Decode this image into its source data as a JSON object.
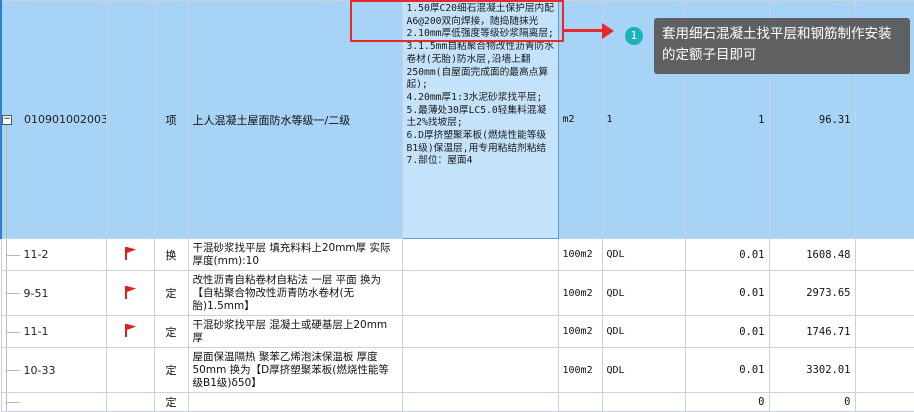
{
  "main_row": {
    "expander": "−",
    "code": "010901002003",
    "type": "项",
    "name": "上人混凝土屋面防水等级一/二级",
    "description": [
      "1.50厚C20细石混凝土保护层内配A6@200双向焊接，随捣随抹光",
      "2.10mm厚低强度等级砂浆隔离层;",
      "3.1.5mm自粘聚合物改性沥青防水卷材(无胎)防水层,沿墙上翻250mm(自屋面完成面的最高点算起);",
      "4.20mm厚1:3水泥砂浆找平层;",
      "5.最薄处30厚LC5.0轻集料混凝土2%找坡层;",
      "6.D厚挤塑聚苯板(燃烧性能等级B1级)保温层,用专用粘结剂粘结",
      "7.部位：屋面4"
    ],
    "unit": "m2",
    "quantity_expr": "1",
    "quantity": "1",
    "price": "96.31"
  },
  "sub_rows": [
    {
      "code": "11-2",
      "flag": true,
      "type": "换",
      "name": "干混砂浆找平层 填充料料上20mm厚  实际厚度(mm):10",
      "unit": "100m2",
      "expr": "QDL",
      "qty": "0.01",
      "price": "1608.48"
    },
    {
      "code": "9-51",
      "flag": true,
      "type": "定",
      "name": "改性沥青自粘卷材自粘法 一层 平面  换为【自粘聚合物改性沥青防水卷材(无胎)1.5mm】",
      "unit": "100m2",
      "expr": "QDL",
      "qty": "0.01",
      "price": "2973.65"
    },
    {
      "code": "11-1",
      "flag": true,
      "type": "定",
      "name": "干混砂浆找平层 混凝土或硬基层上20mm厚",
      "unit": "100m2",
      "expr": "QDL",
      "qty": "0.01",
      "price": "1746.71"
    },
    {
      "code": "10-33",
      "flag": false,
      "type": "定",
      "name": "屋面保温隔热 聚苯乙烯泡沫保温板 厚度50mm  换为【D厚挤塑聚苯板(燃烧性能等级B1级)δ50】",
      "unit": "100m2",
      "expr": "QDL",
      "qty": "0.01",
      "price": "3302.01"
    },
    {
      "code": "",
      "flag": false,
      "type": "定",
      "name": "",
      "unit": "",
      "expr": "",
      "qty": "0",
      "price": "0"
    }
  ],
  "annotation": {
    "badge": "1",
    "text": "套用细石混凝土找平层和钢筋制作安装的定额子目即可"
  },
  "colors": {
    "selected_row": "#a7d3f7",
    "highlight_box": "#e8292b",
    "flag": "#e02020",
    "badge": "#19b3b9",
    "tooltip_bg": "#5f6062"
  }
}
